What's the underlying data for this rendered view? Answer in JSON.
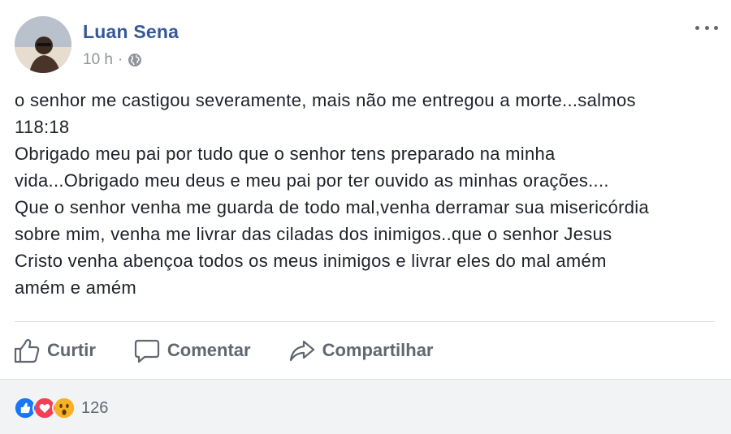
{
  "post": {
    "author": "Luan Sena",
    "time": "10 h",
    "separator": "·",
    "privacy_icon": "globe-icon",
    "options_icon": "more-options-icon",
    "text_lines": [
      "o senhor me castigou severamente, mais não me entregou a morte...salmos",
      "118:18",
      "Obrigado meu pai por tudo que o senhor tens preparado na minha",
      "vida...Obrigado meu deus e meu pai por ter ouvido as minhas orações....",
      "Que o senhor venha me guarda de todo mal,venha derramar sua misericórdia",
      "sobre mim, venha me livrar das ciladas dos inimigos..que o senhor Jesus",
      "Cristo venha abençoa todos os meus inimigos e livrar eles do mal amém",
      "amém e amém"
    ]
  },
  "actions": {
    "like_label": "Curtir",
    "comment_label": "Comentar",
    "share_label": "Compartilhar"
  },
  "reactions": {
    "icons": [
      "like-reaction-icon",
      "love-reaction-icon",
      "wow-reaction-icon"
    ],
    "count": "126"
  },
  "colors": {
    "author": "#365899",
    "meta": "#90949c",
    "text": "#1d2129",
    "action": "#606770",
    "like_blue": "#1877f2",
    "love_red": "#f33e58",
    "wow_yellow": "#f7b125"
  }
}
